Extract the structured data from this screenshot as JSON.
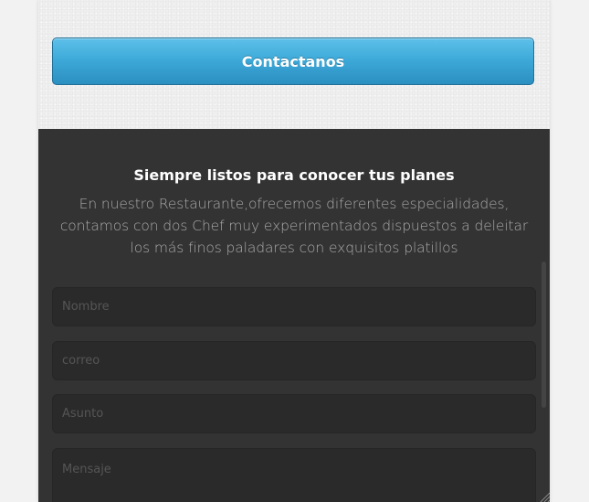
{
  "top": {
    "contact_button_label": "Contactanos"
  },
  "contact_section": {
    "title": "Siempre listos para conocer tus planes",
    "description": "En nuestro Restaurante,ofrecemos diferentes especialidades, contamos con dos Chef muy experimentados dispuestos a deleitar los más finos paladares con exquisitos platillos",
    "form": {
      "nombre_placeholder": "Nombre",
      "correo_placeholder": "correo",
      "asunto_placeholder": "Asunto",
      "mensaje_placeholder": "Mensaje"
    }
  },
  "colors": {
    "button_accent": "#3eaad9",
    "dark_background": "#333333",
    "page_background": "#f2f2f2"
  },
  "icons": {
    "resize_handle": "resize-grip-icon"
  }
}
